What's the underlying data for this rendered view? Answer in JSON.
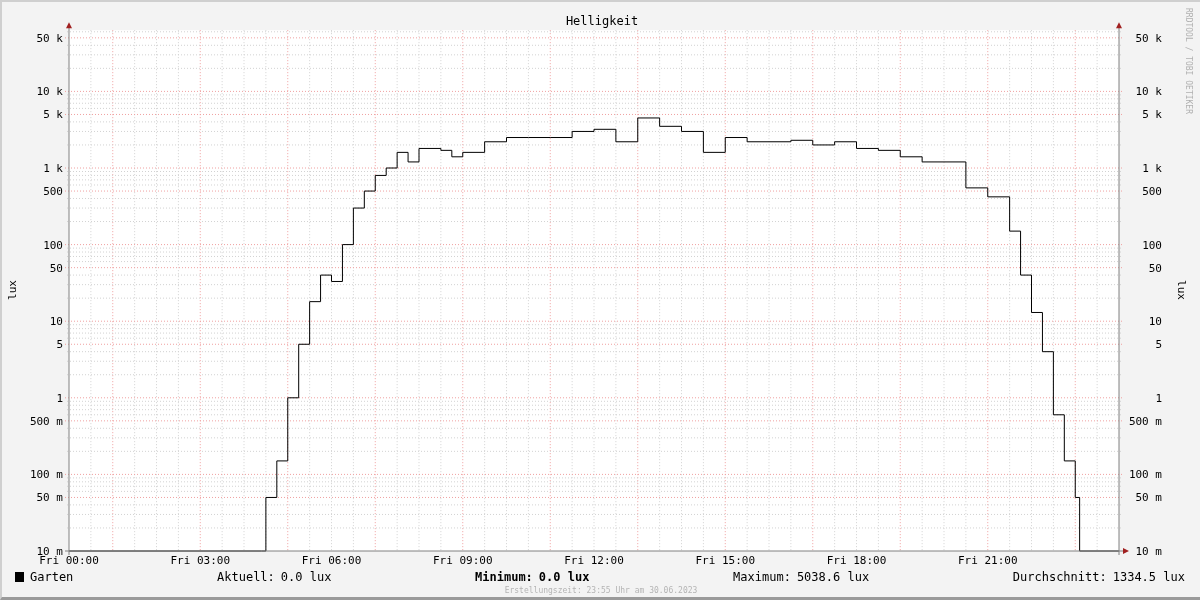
{
  "chart": {
    "title": "Helligkeit",
    "left_axis": {
      "label": "lux",
      "ticks": [
        "50 k",
        "10 k",
        "5 k",
        "1 k",
        "500",
        "100",
        "50",
        "10",
        "5",
        "1",
        "500 m",
        "100 m",
        "50 m",
        "10 m"
      ]
    },
    "right_axis": {
      "label": "lux",
      "ticks": [
        "50 k",
        "10 k",
        "5 k",
        "1 k",
        "500",
        "100",
        "50",
        "10",
        "5",
        "1",
        "500 m",
        "100 m",
        "50 m",
        "10 m"
      ]
    },
    "x_axis": {
      "ticks": [
        "Fri 00:00",
        "Fri 03:00",
        "Fri 06:00",
        "Fri 09:00",
        "Fri 12:00",
        "Fri 15:00",
        "Fri 18:00",
        "Fri 21:00"
      ]
    },
    "credit": "RRDTOOL / TOBI OETIKER"
  },
  "legend": {
    "series": {
      "name": "Garten",
      "color": "#000000"
    },
    "stats": [
      {
        "label": "Aktuell:",
        "value": "0.0 lux",
        "bold": false
      },
      {
        "label": "Minimum:",
        "value": "0.0 lux",
        "bold": true
      },
      {
        "label": "Maximum:",
        "value": "5038.6 lux",
        "bold": false
      },
      {
        "label": "Durchschnitt:",
        "value": "1334.5 lux",
        "bold": false
      }
    ]
  },
  "footer": "Erstellungszeit: 23:55 Uhr am 30.06.2023"
}
